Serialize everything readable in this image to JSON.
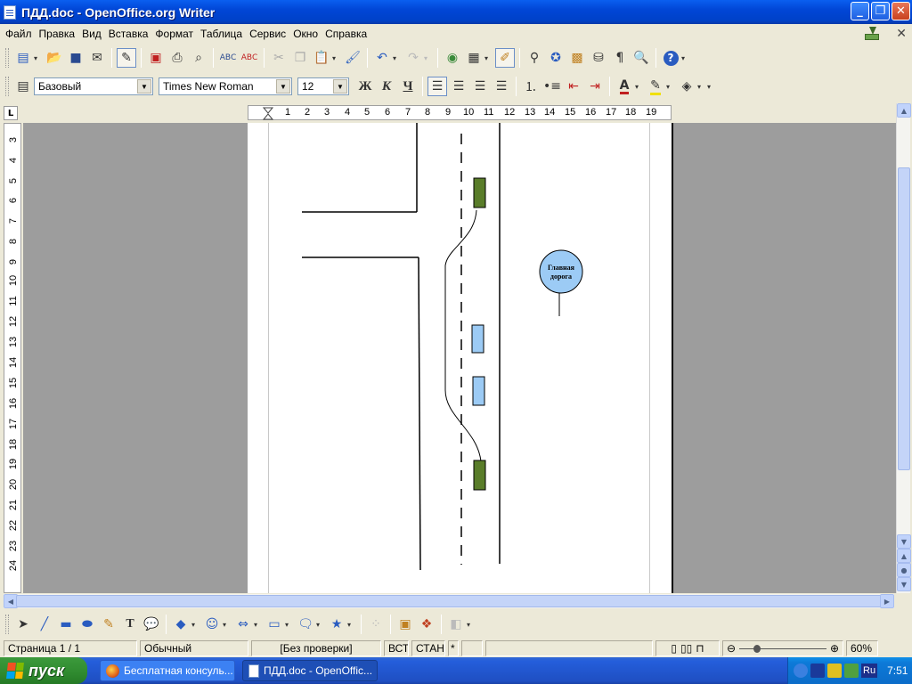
{
  "window": {
    "title": "ПДД.doc - OpenOffice.org Writer"
  },
  "menu": [
    "Файл",
    "Правка",
    "Вид",
    "Вставка",
    "Формат",
    "Таблица",
    "Сервис",
    "Окно",
    "Справка"
  ],
  "format_bar": {
    "style": "Базовый",
    "font": "Times New Roman",
    "size": "12",
    "bold": "Ж",
    "italic": "К",
    "underline": "Ч"
  },
  "ruler": {
    "h_labels": [
      "1",
      "2",
      "3",
      "4",
      "5",
      "6",
      "7",
      "8",
      "9",
      "10",
      "11",
      "12",
      "13",
      "14",
      "15",
      "16",
      "17",
      "18",
      "19"
    ],
    "v_labels": [
      "3",
      "4",
      "5",
      "6",
      "7",
      "8",
      "9",
      "10",
      "11",
      "12",
      "13",
      "14",
      "15",
      "16",
      "17",
      "18",
      "19",
      "20",
      "21",
      "22",
      "23",
      "24"
    ]
  },
  "document": {
    "sign_text_line1": "Главная",
    "sign_text_line2": "дорога",
    "colors": {
      "car_green": "#5a7d2a",
      "car_blue": "#9ccbf5",
      "sign_fill": "#9ccbf5"
    }
  },
  "status": {
    "page": "Страница  1 / 1",
    "style": "Обычный",
    "spellcheck": "[Без проверки]",
    "insert": "ВСТ",
    "selection": "СТАНД",
    "modified": "*",
    "zoom": "60%"
  },
  "taskbar": {
    "start": "пуск",
    "tasks": [
      "Бесплатная консуль...",
      "ПДД.doc - OpenOffic..."
    ],
    "lang": "Ru",
    "clock": "7:51"
  }
}
